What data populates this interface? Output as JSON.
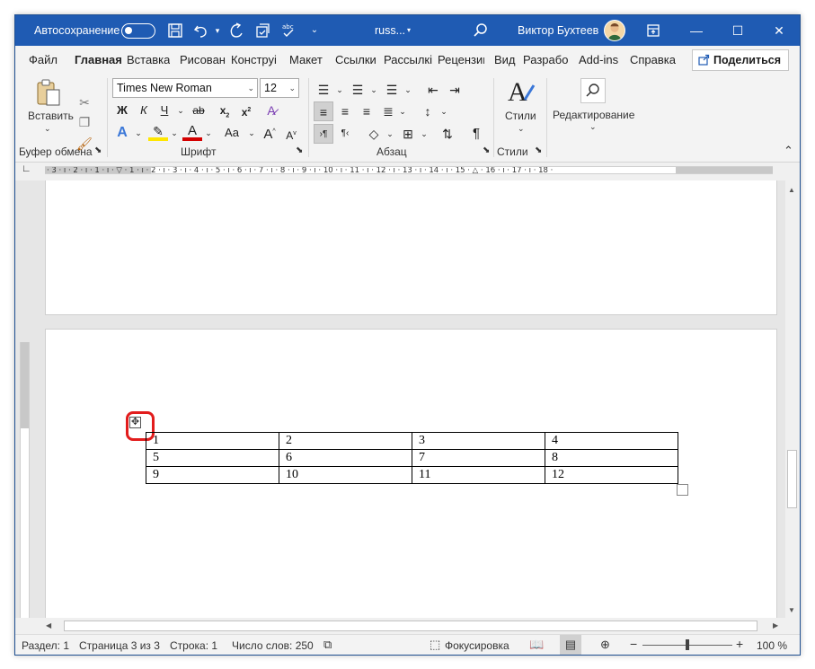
{
  "titlebar": {
    "autosave_label": "Автосохранение",
    "doc_name": "russ...",
    "user_name": "Виктор Бухтеев",
    "icons": [
      "save-icon",
      "undo-icon",
      "redo-icon",
      "check-icon",
      "spellcheck-icon",
      "customize-icon",
      "search-icon",
      "ribbon-display-icon",
      "minimize-icon",
      "maximize-icon",
      "close-icon"
    ]
  },
  "ribbon_tabs": [
    "Файл",
    "Главная",
    "Вставка",
    "Рисован",
    "Конструі",
    "Макет",
    "Ссылки",
    "Рассылкі",
    "Рецензиг",
    "Вид",
    "Разрабо",
    "Add-ins",
    "Справка"
  ],
  "share_label": "Поделиться",
  "clipboard": {
    "paste_label": "Вставить",
    "group_label": "Буфер обмена"
  },
  "font": {
    "font_name": "Times New Roman",
    "font_size": "12",
    "bold": "Ж",
    "italic": "К",
    "underline": "Ч",
    "strikethrough": "ab",
    "subscript": "x",
    "superscript": "x",
    "change_case": "Aa",
    "grow": "A",
    "shrink": "A",
    "group_label": "Шрифт"
  },
  "paragraph": {
    "group_label": "Абзац",
    "pilcrow": "¶"
  },
  "styles": {
    "label": "Стили",
    "group_label": "Стили"
  },
  "editing": {
    "label": "Редактирование"
  },
  "ruler": {
    "text": "· 3 · ı · 2 · ı · 1 · ı · ▽ · 1 · ı · 2 · ı · 3 · ı · 4 · ı · 5 · ı · 6 · ı · 7 · ı · 8 · ı · 9 · ı · 10 · ı · 11 · ı · 12 · ı · 13 · ı · 14 · ı · 15 · △ · 16 · ı · 17 · ı · 18 ·"
  },
  "table": {
    "rows": [
      [
        "1",
        "2",
        "3",
        "4"
      ],
      [
        "5",
        "6",
        "7",
        "8"
      ],
      [
        "9",
        "10",
        "11",
        "12"
      ]
    ]
  },
  "statusbar": {
    "section": "Раздел: 1",
    "page": "Страница 3 из 3",
    "line": "Строка: 1",
    "words": "Число слов: 250",
    "focus": "Фокусировка",
    "zoom": "100 %",
    "zoom_percent": 100
  },
  "colors": {
    "titlebar": "#1f5bb3",
    "highlight": "#e21c1c",
    "text_highlight": "#ffe600",
    "font_color": "#d40000"
  }
}
